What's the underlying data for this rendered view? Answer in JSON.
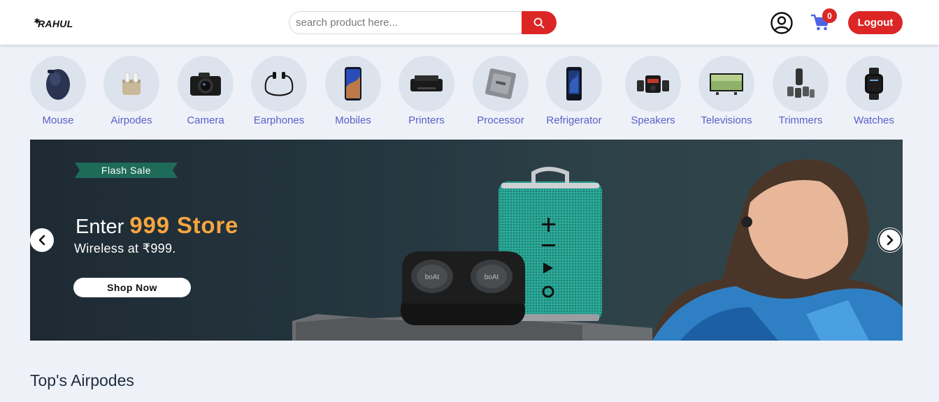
{
  "header": {
    "logo_text": "RAHUL",
    "search": {
      "placeholder": "search product here..."
    },
    "cart_count": "0",
    "logout_label": "Logout"
  },
  "categories": [
    {
      "label": "Mouse",
      "icon": "mouse-icon"
    },
    {
      "label": "Airpodes",
      "icon": "airpods-icon"
    },
    {
      "label": "Camera",
      "icon": "camera-icon"
    },
    {
      "label": "Earphones",
      "icon": "earphones-icon"
    },
    {
      "label": "Mobiles",
      "icon": "mobile-icon"
    },
    {
      "label": "Printers",
      "icon": "printer-icon"
    },
    {
      "label": "Processor",
      "icon": "processor-icon"
    },
    {
      "label": "Refrigerator",
      "icon": "refrigerator-icon"
    },
    {
      "label": "Speakers",
      "icon": "speaker-icon"
    },
    {
      "label": "Televisions",
      "icon": "television-icon"
    },
    {
      "label": "Trimmers",
      "icon": "trimmer-icon"
    },
    {
      "label": "Watches",
      "icon": "watch-icon"
    }
  ],
  "banner": {
    "tag": "Flash Sale",
    "enter": "Enter",
    "store": "999 Store",
    "subtitle": "Wireless at ₹999.",
    "cta": "Shop Now",
    "product_brand": "boAt"
  },
  "section": {
    "title": "Top's Airpodes"
  },
  "colors": {
    "accent": "#dc2626",
    "category_text": "#5b5fc7",
    "store_highlight": "#f7a540",
    "flash_tag": "#1f6b5a"
  }
}
